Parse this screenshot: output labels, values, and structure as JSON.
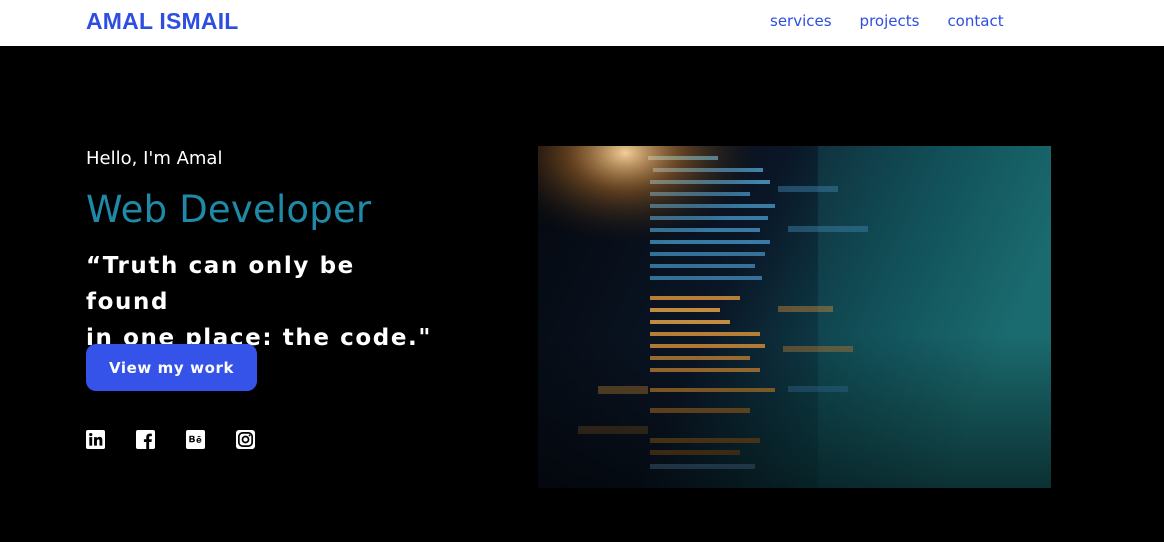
{
  "header": {
    "logo": "AMAL ISMAIL",
    "nav": [
      {
        "label": "services"
      },
      {
        "label": "projects"
      },
      {
        "label": "contact"
      }
    ]
  },
  "hero": {
    "greeting": "Hello, I'm Amal",
    "role": "Web Developer",
    "quote_line1": "“Truth can only be found",
    "quote_line2": "in one place: the code.\"",
    "cta_label": "View my work"
  },
  "socials": [
    {
      "icon": "linkedin-icon"
    },
    {
      "icon": "facebook-icon"
    },
    {
      "icon": "behance-icon"
    },
    {
      "icon": "instagram-icon"
    }
  ],
  "colors": {
    "brand": "#2d4ee0",
    "accent": "#1f8aa8",
    "button": "#3553e8",
    "background": "#000000"
  }
}
